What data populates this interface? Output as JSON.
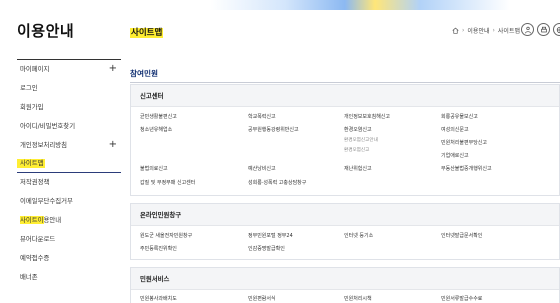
{
  "sidebar": {
    "title": "이용안내",
    "items": [
      {
        "label": "마이페이지",
        "expandable": true
      },
      {
        "label": "로그인",
        "expandable": false
      },
      {
        "label": "회원가입",
        "expandable": false
      },
      {
        "label": "아이디/비밀번호찾기",
        "expandable": false
      },
      {
        "label": "개인정보처리방침",
        "expandable": true
      },
      {
        "label": "사이트맵",
        "expandable": false
      },
      {
        "label": "저작권정책",
        "expandable": false
      },
      {
        "label": "이메일무단수집거부",
        "expandable": false
      },
      {
        "label_prefix": "사이트이",
        "label_rest": "용안내",
        "expandable": false
      },
      {
        "label": "뷰어다운로드",
        "expandable": false
      },
      {
        "label": "예약접수증",
        "expandable": false
      },
      {
        "label": "배너존",
        "expandable": false
      }
    ],
    "plus_glyph": "+"
  },
  "header": {
    "title": "사이트맵",
    "breadcrumb": [
      "이용안내",
      "사이트맵"
    ]
  },
  "section": {
    "title": "참여민원"
  },
  "boxes": [
    {
      "title": "신고센터",
      "links": [
        [
          "균민생활불편신고",
          "학교폭력신고",
          "개인정보보호침해신고",
          "회룡공유물보신고"
        ],
        [
          "청소년유해업소",
          "공무원행동강령위반신고",
          "환경오염신고",
          "여성의신문고"
        ],
        [
          "",
          "",
          "환경오염신고안내",
          "민원처리불편부당신고"
        ],
        [
          "",
          "",
          "환경오염신고",
          "기업애로신고"
        ],
        [
          "불법의료신고",
          "예산낭비신고",
          "재난위험신고",
          "부동산불법중개행위신고"
        ],
        [
          "갑질 및 부정부패 신고센터",
          "성희롱·성폭력 고충상담창구",
          "",
          ""
        ]
      ]
    },
    {
      "title": "온라인민원창구",
      "links": [
        [
          "원도군 새올전자민원창구",
          "정부민원포털 정부24",
          "인터넷 등기소",
          "인터넷발급문서확인"
        ],
        [
          "주민등록진위확인",
          "인감증명발급확인",
          "",
          ""
        ]
      ]
    },
    {
      "title": "민원서비스",
      "links": [
        [
          "민원봉사과배치도",
          "민원편람서식",
          "민원처리시책",
          "민원서류발급수수료"
        ]
      ]
    }
  ],
  "colors": {
    "accent": "#ffee33",
    "navy": "#0b2a6e",
    "border": "#dfe2e8",
    "header_bg": "#f4f5f7"
  },
  "icons": [
    "home-icon",
    "share-icon",
    "print-icon",
    "sitemap-icon"
  ]
}
